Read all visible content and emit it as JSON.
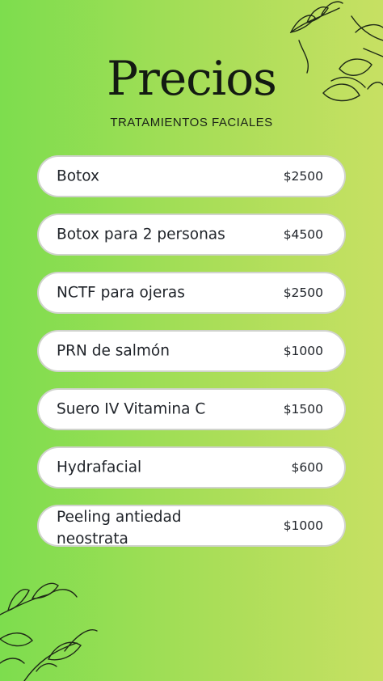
{
  "header": {
    "title": "Precios",
    "subtitle": "TRATAMIENTOS FACIALES"
  },
  "prices": [
    {
      "name": "Botox",
      "price": "$2500"
    },
    {
      "name": "Botox para 2 personas",
      "price": "$4500"
    },
    {
      "name": "NCTF para ojeras",
      "price": "$2500"
    },
    {
      "name": "PRN de salmón",
      "price": "$1000"
    },
    {
      "name": "Suero IV Vitamina C",
      "price": "$1500"
    },
    {
      "name": "Hydrafacial",
      "price": "$600"
    },
    {
      "name": "Peeling antiedad\n neostrata",
      "price": "$1000"
    }
  ],
  "colors": {
    "background_left": "#7ddd4e",
    "background_right": "#c7e063",
    "card": "#ffffff",
    "text": "#20242a"
  },
  "decorations": [
    "leaf-branch-top-right-icon",
    "leaf-branch-bottom-left-icon"
  ]
}
